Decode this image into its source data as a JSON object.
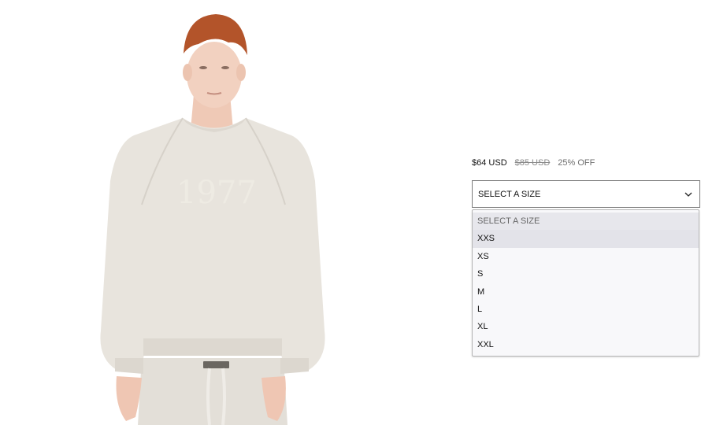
{
  "product": {
    "image_alt": "Model wearing oatmeal crewneck sweatshirt",
    "graphic_text": "1977"
  },
  "pricing": {
    "current": "$64 USD",
    "original": "$85 USD",
    "discount": "25% OFF"
  },
  "size_select": {
    "selected_label": "SELECT A SIZE",
    "options": [
      "SELECT A SIZE",
      "XXS",
      "XS",
      "S",
      "M",
      "L",
      "XL",
      "XXL"
    ]
  },
  "icons": {
    "select_arrow": "chevron-down-icon"
  },
  "colors": {
    "sweatshirt": "#e7e3dc",
    "hair": "#b3542a",
    "border": "#7a7a7a",
    "dropdown_bg": "#f8f8fa",
    "highlight": "#e3e3e9"
  }
}
